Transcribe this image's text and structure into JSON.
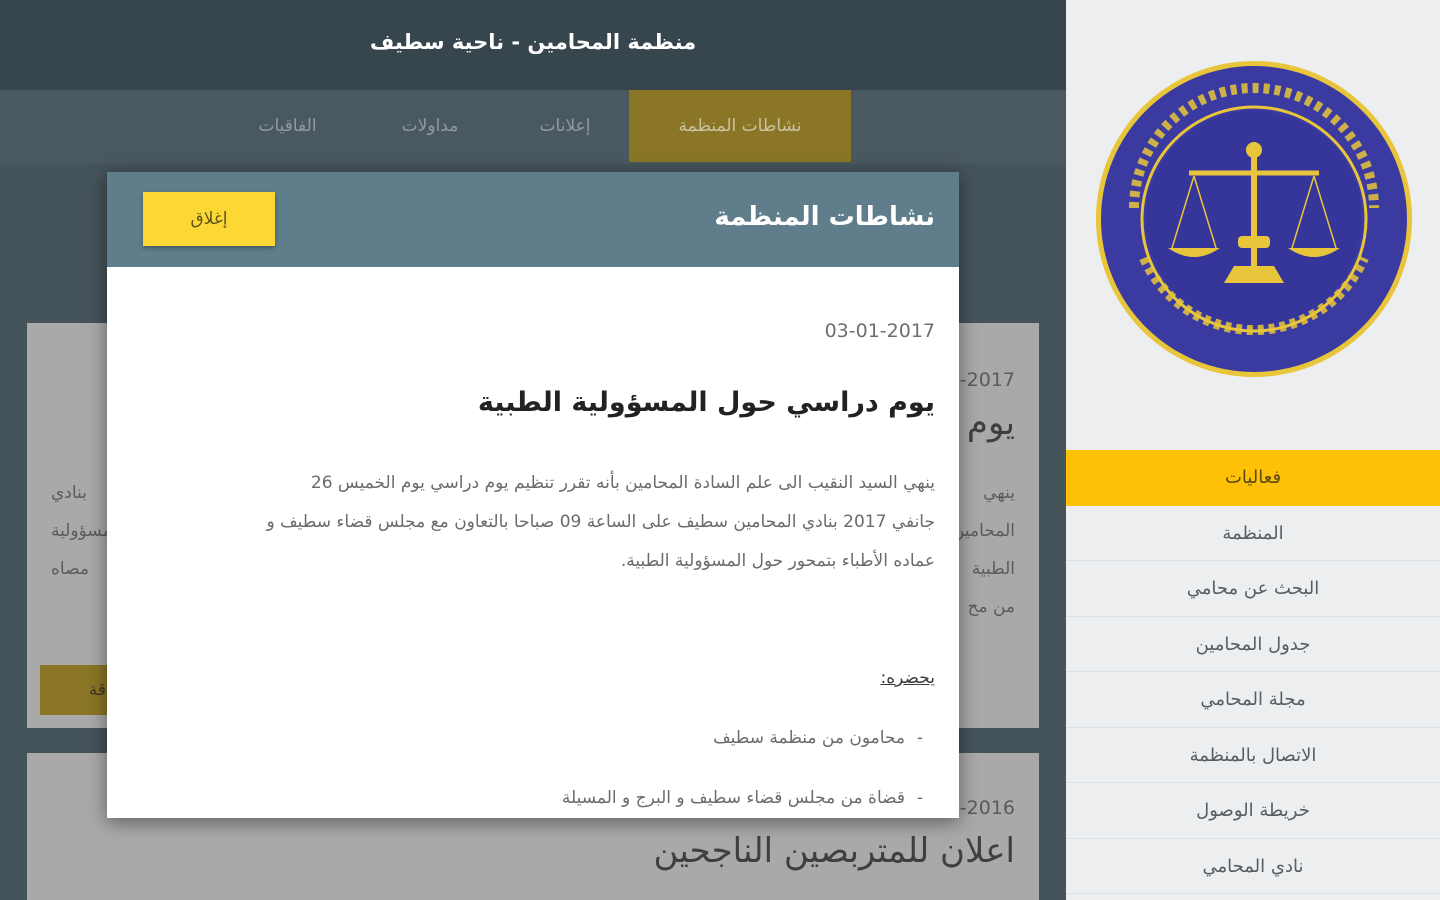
{
  "header": {
    "title": "منظمة المحامين - ناحية سطيف"
  },
  "tabs": [
    {
      "label": "نشاطات المنظمة",
      "active": true
    },
    {
      "label": "إعلانات",
      "active": false
    },
    {
      "label": "مداولات",
      "active": false
    },
    {
      "label": "الفاقيات",
      "active": false
    }
  ],
  "background_cards": [
    {
      "date_fragment": "-2017",
      "heading_fragment": "يوم",
      "left_fragments": [
        "بنادي",
        "المسؤولية",
        "مصاه"
      ],
      "right_fragments": [
        "ينهي",
        "المحامين",
        "الطبية",
        "من مح"
      ],
      "button_fragment": "قة"
    },
    {
      "date_fragment": "-2016",
      "heading": "اعلان للمتربصين الناجحين"
    }
  ],
  "sidebar": {
    "nav": [
      {
        "label": "فعاليات",
        "active": true
      },
      {
        "label": "المنظمة"
      },
      {
        "label": "البحث عن محامي"
      },
      {
        "label": "جدول المحامين"
      },
      {
        "label": "مجلة المحامي"
      },
      {
        "label": "الاتصال بالمنظمة"
      },
      {
        "label": "خريطة الوصول"
      },
      {
        "label": "نادي المحامي"
      }
    ]
  },
  "modal": {
    "title": "نشاطات المنظمة",
    "close_label": "إغلاق",
    "date": "03-01-2017",
    "heading": "يوم دراسي حول المسؤولية الطبية",
    "body_lines": [
      "ينهي السيد النقيب الى علم السادة المحامين بأنه تقرر تنظيم يوم دراسي يوم الخميس 26",
      "جانفي 2017 بنادي المحامين سطيف على الساعة 09 صباحا بالتعاون مع مجلس قضاء سطيف و",
      "عماده الأطباء بتمحور حول المسؤولية الطبية."
    ],
    "attendees_label": "يحضره:",
    "attendees": [
      "محامون من منظمة سطيف",
      "قضاة من مجلس قضاء سطيف و البرج و المسيلة"
    ]
  },
  "colors": {
    "accent": "#ffc107",
    "modal_header": "#607d8b",
    "close_button": "#fdd835",
    "logo_blue": "#3a3aa0",
    "logo_gold": "#e8c53a"
  },
  "icons": {
    "logo": "scales-of-justice-seal"
  }
}
